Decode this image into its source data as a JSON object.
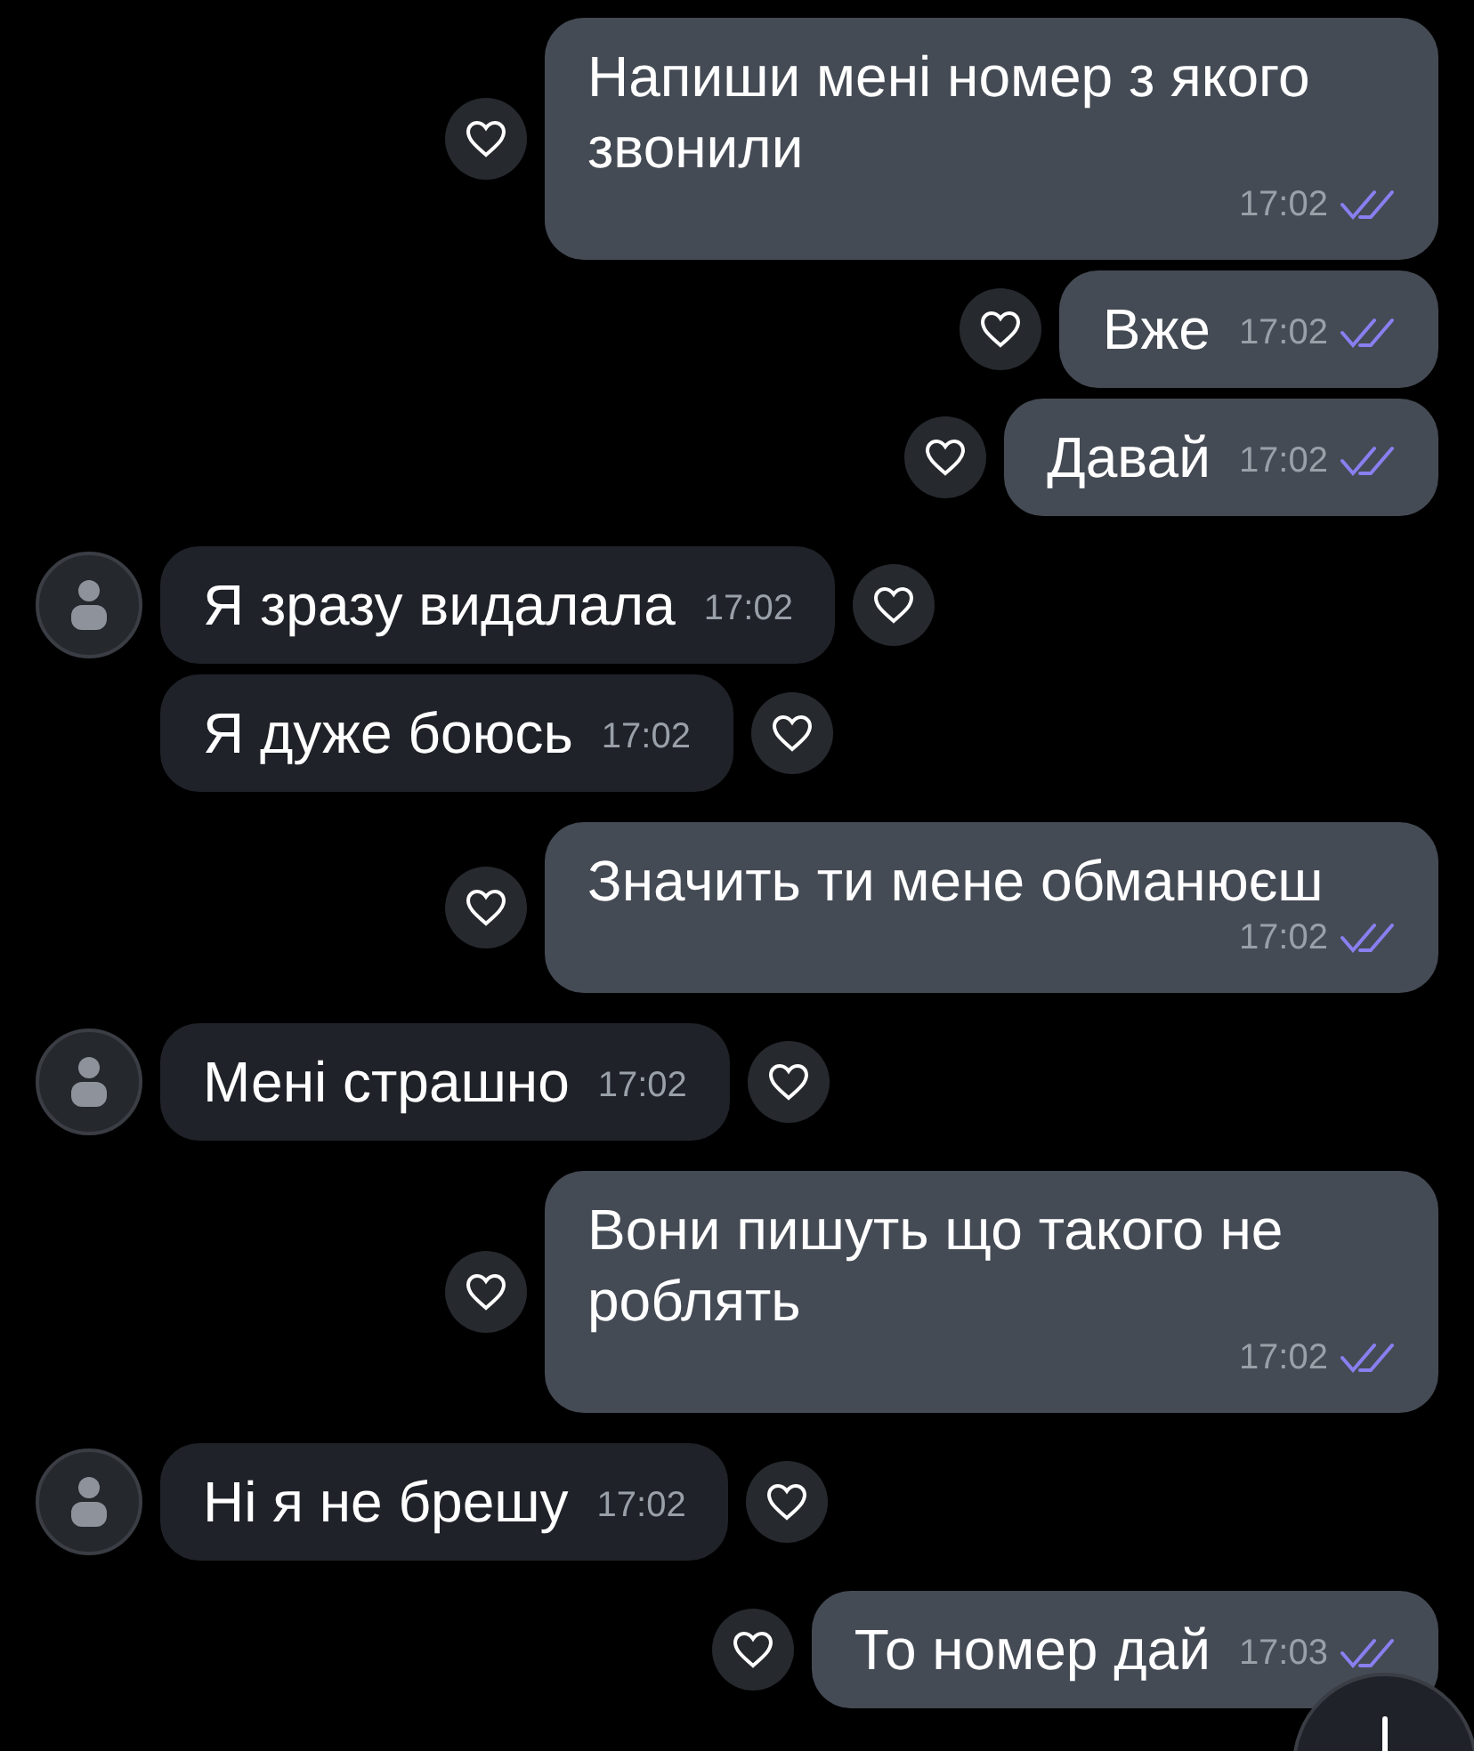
{
  "messages": [
    {
      "kind": "out",
      "text": "Напиши мені номер з якого звонили",
      "time": "17:02",
      "read": true
    },
    {
      "kind": "out",
      "text": "Вже",
      "time": "17:02",
      "read": true
    },
    {
      "kind": "out",
      "text": "Давай",
      "time": "17:02",
      "read": true
    },
    {
      "kind": "in",
      "text": "Я зразу видалала",
      "time": "17:02",
      "avatar": true
    },
    {
      "kind": "in",
      "text": "Я дуже боюсь",
      "time": "17:02",
      "avatar": false
    },
    {
      "kind": "out",
      "text": "Значить ти мене обманюєш",
      "time": "17:02",
      "read": true
    },
    {
      "kind": "in",
      "text": "Мені страшно",
      "time": "17:02",
      "avatar": true
    },
    {
      "kind": "out",
      "text": "Вони пишуть що такого не роблять",
      "time": "17:02",
      "read": true
    },
    {
      "kind": "in",
      "text": "Ні я не брешу",
      "time": "17:02",
      "avatar": true
    },
    {
      "kind": "out",
      "text": "То номер дай",
      "time": "17:03",
      "read": true
    }
  ]
}
